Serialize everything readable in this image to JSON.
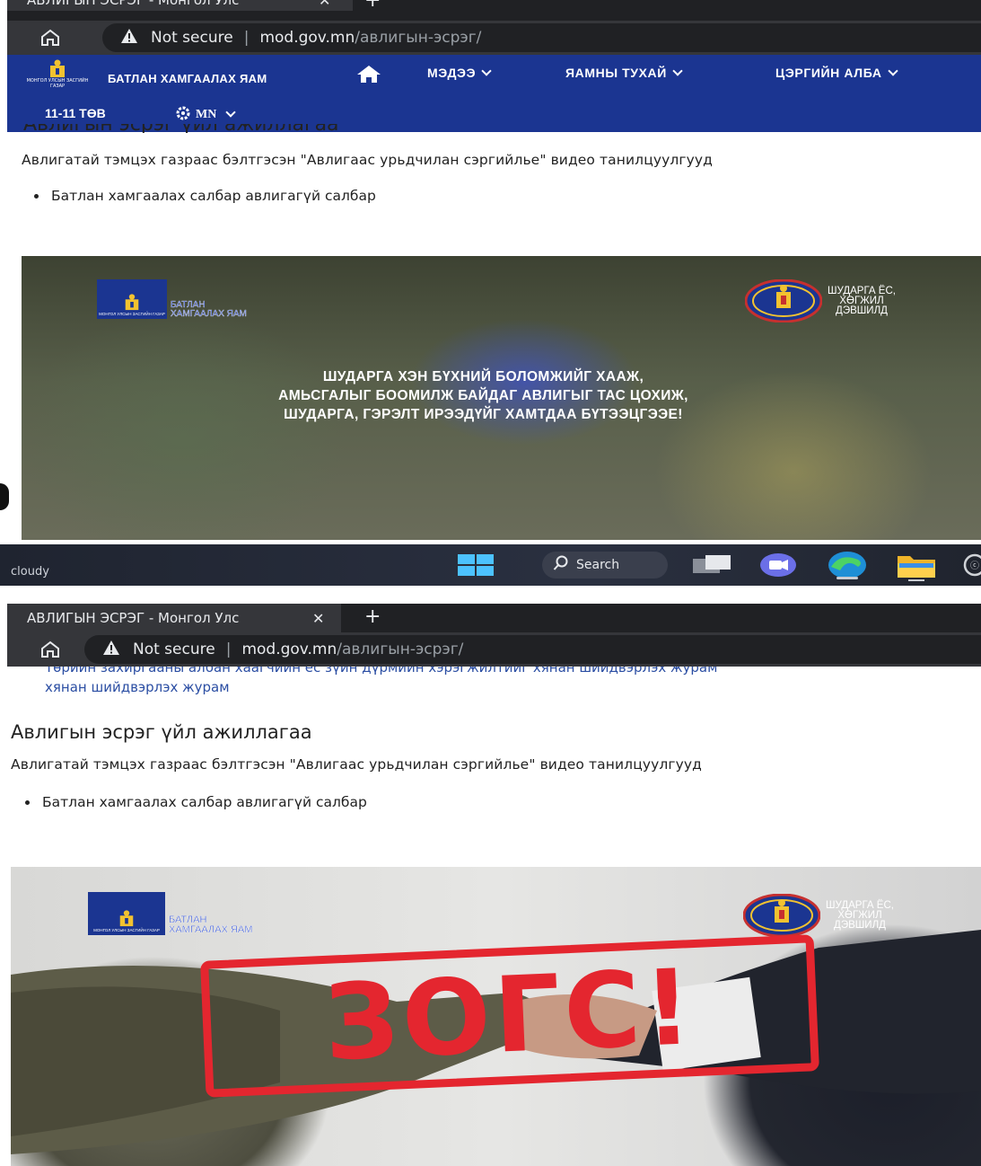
{
  "browser": {
    "tab_title_partial": "АВЛИГЫН ЭСРЭГ - Монгол Улс",
    "tab_title": "АВЛИГЫН ЭСРЭГ - Монгол Улс",
    "not_secure": "Not secure",
    "url_host": "mod.gov.mn",
    "url_path": "/авлигын-эсрэг/",
    "new_tab": "+",
    "close_tab": "✕"
  },
  "site_nav": {
    "emblem_caption": "МОНГОЛ УЛСЫН ЗАСГИЙН ГАЗАР",
    "brand": "БАТЛАН ХАМГААЛАХ ЯАМ",
    "items": [
      {
        "label": "МЭДЭЭ"
      },
      {
        "label": "ЯАМНЫ ТУХАЙ"
      },
      {
        "label": "ЦЭРГИЙН АЛБА"
      }
    ],
    "hotline": "11-11 ТӨВ",
    "language": "MN"
  },
  "section1": {
    "cut_heading": "Авлигын эсрэг үйл ажиллагаа",
    "intro": "Авлигатай тэмцэх газраас бэлтгэсэн \"Авлигаас урьдчилан сэргийлье\" видео танилцуулгууд",
    "bullet": "Батлан хамгаалах салбар авлигагүй салбар"
  },
  "video1": {
    "logo_caption": "МОНГОЛ УЛСЫН ЗАСГИЙН ГАЗАР",
    "logo_line1": "БАТЛАН",
    "logo_line2": "ХАМГААЛАХ ЯАМ",
    "seal_line1": "ШУДАРГА ЁС,",
    "seal_line2": "ХӨГЖИЛ",
    "seal_line3": "ДЭВШИЛД",
    "line1": "ШУДАРГА ХЭН БҮХНИЙ БОЛОМЖИЙГ ХААЖ,",
    "line2": "АМЬСГАЛЫГ БООМИЛЖ БАЙДАГ АВЛИГЫГ ТАС ЦОХИЖ,",
    "line3": "ШУДАРГА, ГЭРЭЛТ ИРЭЭДҮЙГ ХАМТДАА БҮТЭЭЦГЭЭЕ!"
  },
  "taskbar": {
    "weather": "cloudy",
    "search": "Search"
  },
  "section2": {
    "cut_link_line": "Төрийн захиргааны албан хаагчийн ёс зүйн дүрмийн хэрэгжилтийг хянан шийдвэрлэх журам",
    "link_line2": "хянан шийдвэрлэх журам",
    "heading": "Авлигын эсрэг үйл ажиллагаа",
    "intro": "Авлигатай тэмцэх газраас бэлтгэсэн \"Авлигаас урьдчилан сэргийлье\" видео танилцуулгууд",
    "bullet": "Батлан хамгаалах салбар авлигагүй салбар"
  },
  "video2": {
    "logo_caption": "МОНГОЛ УЛСЫН ЗАСГИЙН ГАЗАР",
    "logo_line1": "БАТЛАН",
    "logo_line2": "ХАМГААЛАХ ЯАМ",
    "seal_line1": "ШУДАРГА ЁС,",
    "seal_line2": "ХӨГЖИЛ",
    "seal_line3": "ДЭВШИЛД",
    "stamp": "ЗОГС!"
  },
  "colors": {
    "nav_blue": "#1b3591",
    "stamp_red": "#e4262f",
    "link_blue": "#2b4ea3"
  }
}
